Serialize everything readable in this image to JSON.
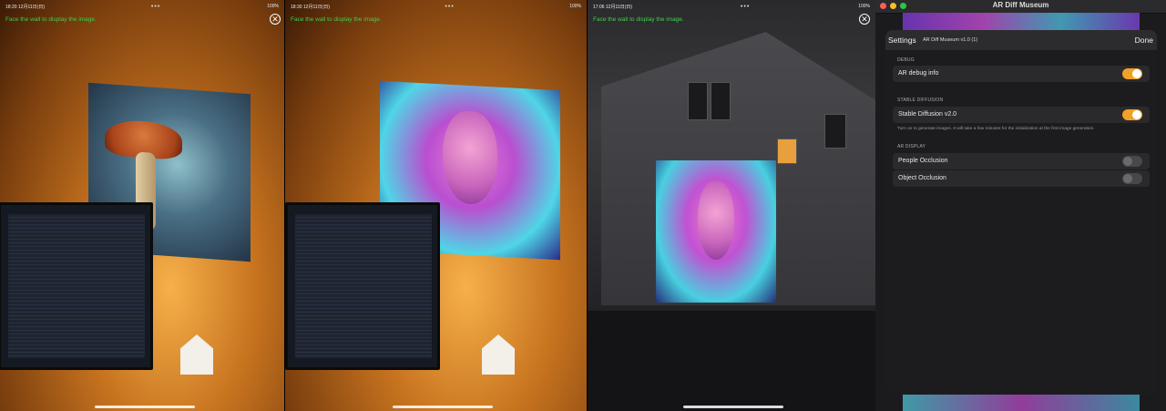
{
  "panels": [
    {
      "time": "18:20",
      "date": "12月11日(日)",
      "battery": "100%",
      "hint": "Face the wall to display the image."
    },
    {
      "time": "18:30",
      "date": "12月11日(日)",
      "battery": "100%",
      "hint": "Face the wall to display the image."
    },
    {
      "time": "17:06",
      "date": "12月11日(日)",
      "battery": "100%",
      "hint": "Face the wall to display the image."
    }
  ],
  "dots": "•••",
  "close_glyph": "✕",
  "mac": {
    "window_title": "AR Diff Museum",
    "header": {
      "left": "Settings",
      "title": "AR Diff Museum v1.0 (1)",
      "done": "Done"
    },
    "sections": [
      {
        "title": "DEBUG",
        "rows": [
          {
            "label": "AR debug info",
            "on": true
          }
        ]
      },
      {
        "title": "STABLE DIFFUSION",
        "rows": [
          {
            "label": "Stable Diffusion v2.0",
            "on": true
          }
        ],
        "description": "Turn on to generate images. It will take a few minutes for the initialization at the first image generation."
      },
      {
        "title": "AR DISPLAY",
        "rows": [
          {
            "label": "People Occlusion",
            "on": false
          },
          {
            "label": "Object Occlusion",
            "on": false
          }
        ]
      }
    ],
    "colors": {
      "toggle_on": "#f1a127",
      "toggle_off": "#48484b",
      "hint_green": "#3ad14a"
    }
  }
}
